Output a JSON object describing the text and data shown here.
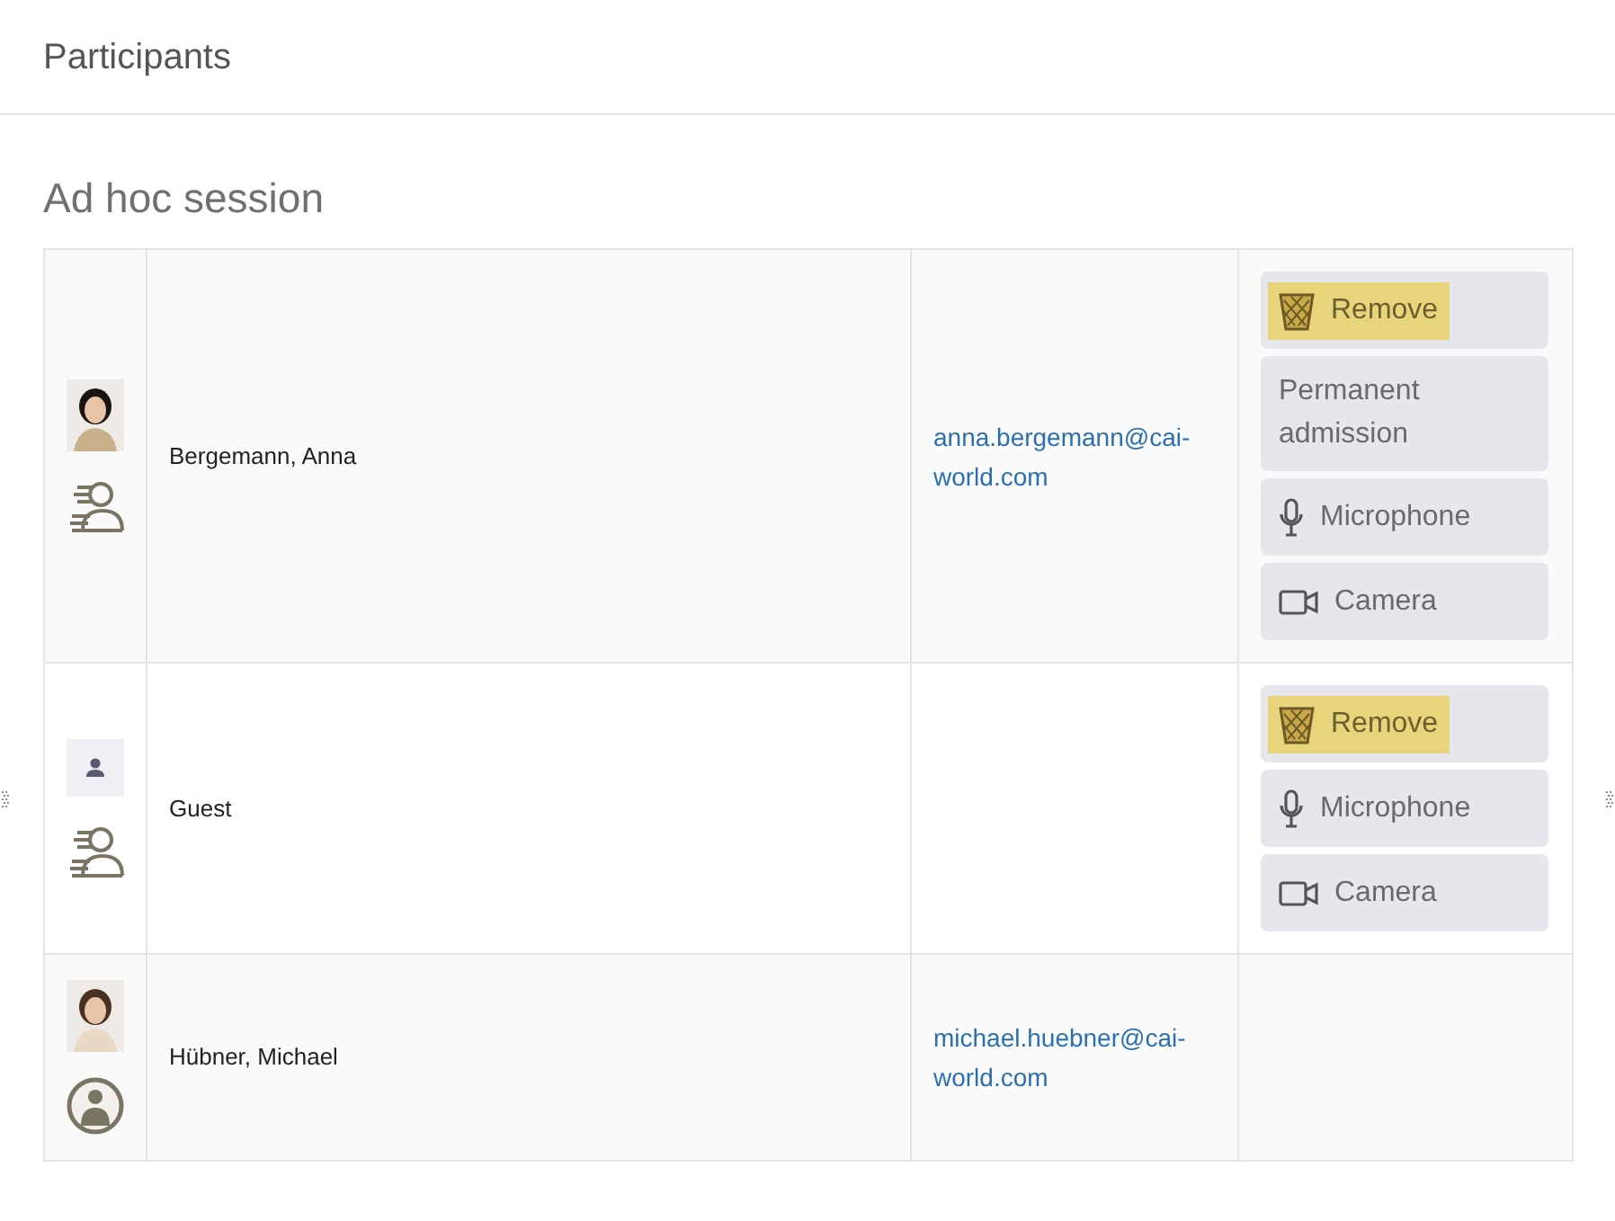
{
  "dialog": {
    "title": "Participants"
  },
  "section": {
    "title": "Ad hoc session"
  },
  "participants": [
    {
      "badge": {
        "kind": "guest"
      },
      "name": "Bergemann, Anna",
      "email": "anna.bergemann@cai-world.com",
      "actions": [
        {
          "kind": "remove",
          "label": "Remove",
          "highlighted": true
        },
        {
          "kind": "text",
          "label": "Permanent admission",
          "highlighted": false
        },
        {
          "kind": "microphone",
          "label": "Microphone",
          "highlighted": false
        },
        {
          "kind": "camera",
          "label": "Camera",
          "highlighted": false
        }
      ]
    },
    {
      "avatar": {
        "kind": "placeholder"
      },
      "badge": {
        "kind": "guest"
      },
      "name": "Guest",
      "actions": [
        {
          "kind": "remove",
          "label": "Remove",
          "highlighted": true
        },
        {
          "kind": "microphone",
          "label": "Microphone",
          "highlighted": false
        },
        {
          "kind": "camera",
          "label": "Camera",
          "highlighted": false
        }
      ]
    },
    {
      "badge": {
        "kind": "member"
      },
      "name": "Hübner, Michael",
      "email": "michael.huebner@cai-world.com"
    }
  ]
}
